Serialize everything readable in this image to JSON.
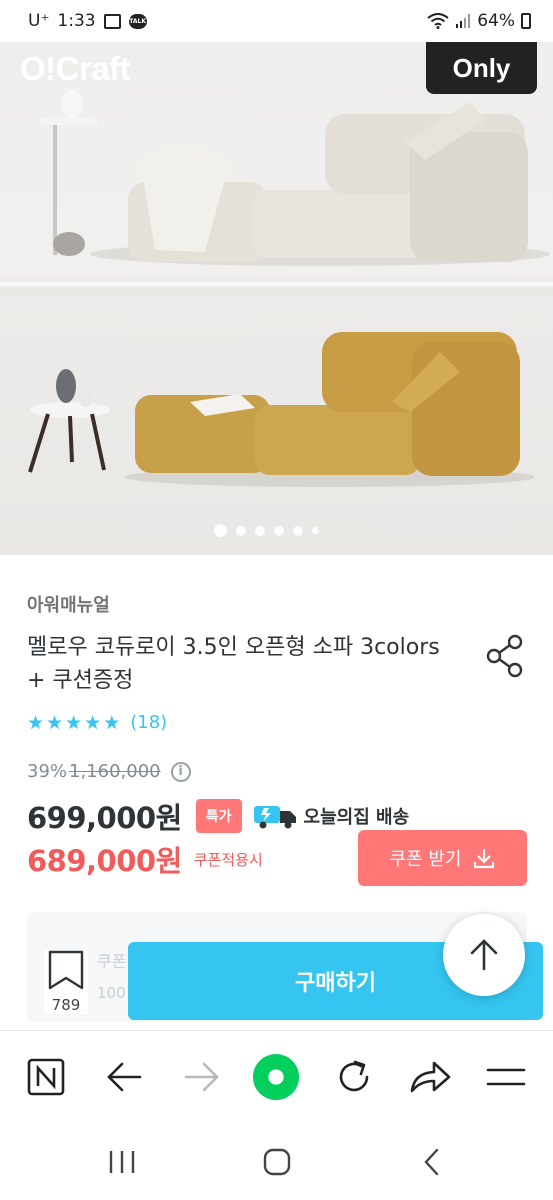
{
  "status_bar": {
    "carrier": "U⁺",
    "time": "1:33",
    "notification_talk_label": "TALK",
    "battery": "64%"
  },
  "hero": {
    "brand_logo": "O!Craft",
    "badge": "Only",
    "image_count": 6,
    "active_index": 0
  },
  "product": {
    "brand": "아워매뉴얼",
    "title": "멜로우 코듀로이 3.5인 오픈형 소파 3colors + 쿠션증정",
    "rating_stars": 5,
    "review_count": "(18)",
    "discount_rate": "39%",
    "original_price": "1,160,000",
    "sale_price": "699,000원",
    "special_badge": "특가",
    "delivery_label": "오늘의집 배송",
    "coupon_price": "689,000원",
    "coupon_note": "쿠폰적용시",
    "coupon_button": "쿠폰 받기"
  },
  "option_panel": {
    "faded_label": "쿠폰",
    "faded_value": "100"
  },
  "buy_bar": {
    "scrap_count": "789",
    "buy_label": "구매하기"
  },
  "colors": {
    "accent": "#35c5f0",
    "sale_red": "#f05b5b",
    "coupon_button": "#ff7777",
    "browser_green": "#03cf5d"
  },
  "icons": {
    "share": "share-icon",
    "info": "info-icon",
    "download": "download-icon",
    "bookmark": "bookmark-icon",
    "arrow_up": "arrow-up-icon"
  }
}
